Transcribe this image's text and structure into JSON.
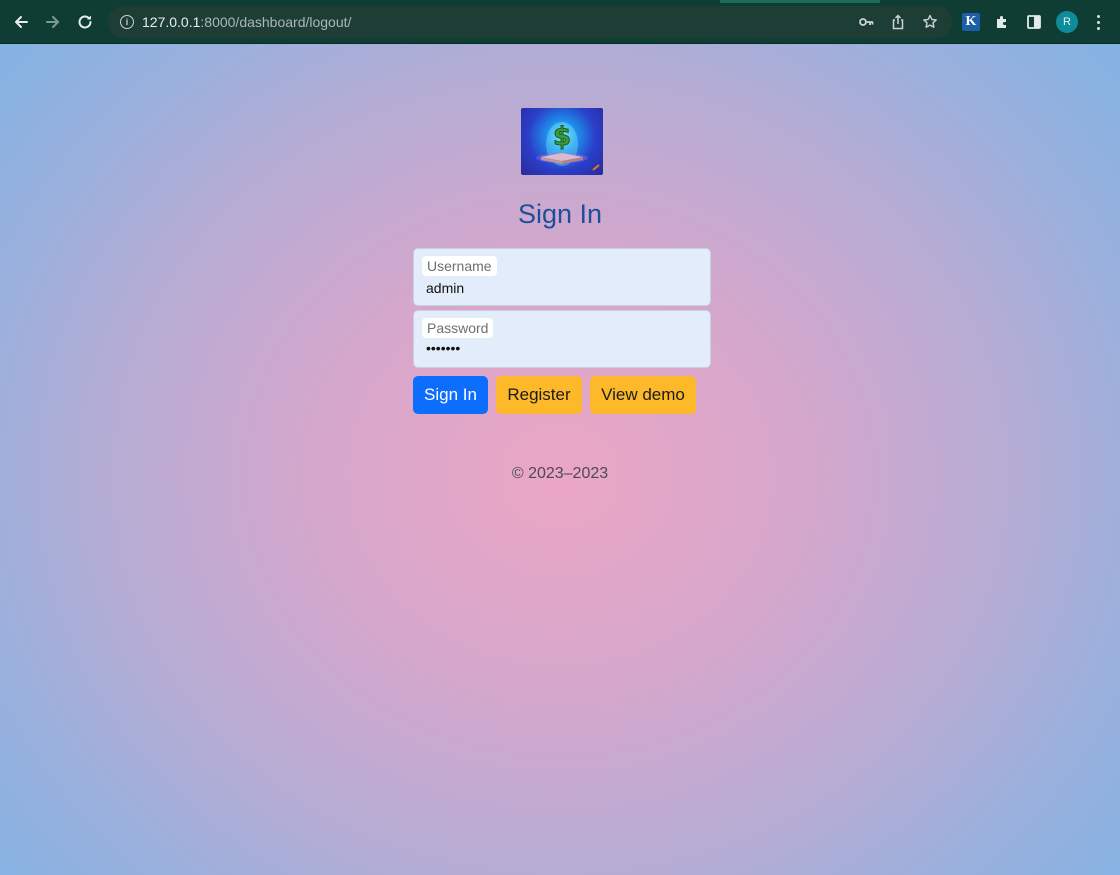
{
  "browser": {
    "url_host": "127.0.0.1",
    "url_rest": ":8000/dashboard/logout/",
    "extension_letter": "K",
    "profile_initial": "R"
  },
  "login": {
    "title": "Sign In",
    "username_label": "Username",
    "username_value": "admin",
    "password_label": "Password",
    "password_value": "•••••••",
    "signin_button": "Sign In",
    "register_button": "Register",
    "demo_button": "View demo"
  },
  "footer": {
    "copyright": "© 2023–2023"
  },
  "colors": {
    "chrome_bg": "#0f3d33",
    "primary": "#0d6efd",
    "warning": "#fdb92a",
    "title": "#1f4f9a"
  }
}
